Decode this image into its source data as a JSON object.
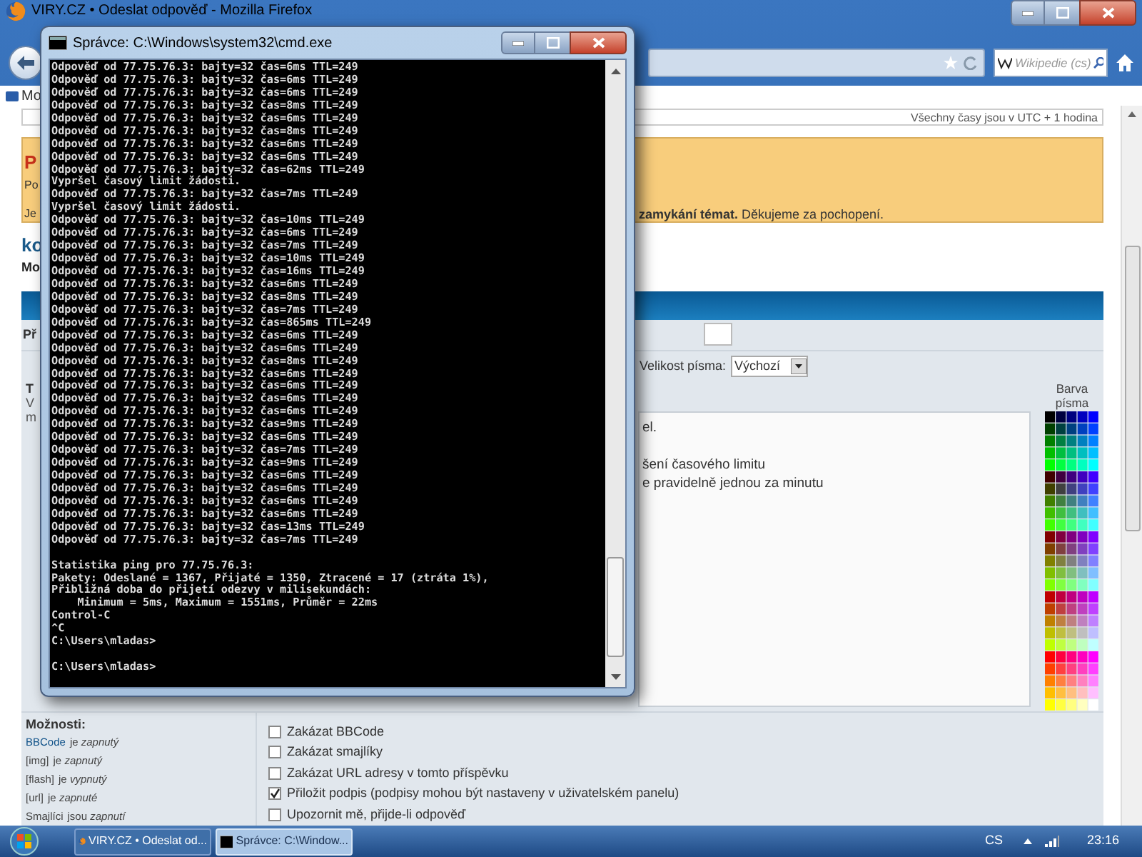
{
  "browser": {
    "title": "VIRY.CZ • Odeslat odpověď - Mozilla Firefox",
    "search": {
      "placeholder": "Wikipedie (cs)"
    },
    "bookmark": "Mo"
  },
  "page": {
    "timezone": "Všechny časy jsou v UTC + 1 hodina",
    "notice": {
      "heading": "P",
      "line_1": "Po",
      "line_2_start": "Je",
      "line_2_end": "**zamykání témat.** Děkujeme za pochopení."
    },
    "topic": {
      "title": "ko",
      "subtitle": "Mo"
    },
    "subject_label": "Př",
    "font_size": {
      "label": "Velikost písma:",
      "value": "Výchozí"
    },
    "help_fragments": [
      "T",
      "V",
      "m"
    ],
    "message_lines": [
      "el.",
      "šení časového limitu",
      "e pravidelně jednou za minutu"
    ],
    "color_label": "Barva písma",
    "options": {
      "heading": "Možnosti:",
      "items": [
        {
          "lead": "BBCode",
          "link": true,
          "rest": "je *zapnutý*"
        },
        {
          "lead": "[img]",
          "link": false,
          "rest": "je *zapnutý*"
        },
        {
          "lead": "[flash]",
          "link": false,
          "rest": "je *vypnutý*"
        },
        {
          "lead": "[url]",
          "link": false,
          "rest": "je *zapnuté*"
        },
        {
          "lead": "Smajlíci",
          "link": false,
          "rest": "jsou *zapnutí*"
        }
      ]
    },
    "checkboxes": [
      {
        "label": "Zakázat BBCode",
        "checked": false
      },
      {
        "label": "Zakázat smajlíky",
        "checked": false
      },
      {
        "label": "Zakázat URL adresy v tomto příspěvku",
        "checked": false
      },
      {
        "label": "Přiložit podpis (podpisy mohou být nastaveny v uživatelském panelu)",
        "checked": true
      },
      {
        "label": "Upozornit mě, přijde-li odpověď",
        "checked": false
      }
    ]
  },
  "console": {
    "title": "Správce: C:\\Windows\\system32\\cmd.exe",
    "lines": [
      {
        "kind": "line",
        "text": "Odpověď od 77.75.76.3: bajty=32 čas=6ms TTL=249"
      },
      {
        "kind": "line",
        "text": "Odpověď od 77.75.76.3: bajty=32 čas=6ms TTL=249"
      },
      {
        "kind": "line",
        "text": "Odpověď od 77.75.76.3: bajty=32 čas=6ms TTL=249"
      },
      {
        "kind": "line",
        "text": "Odpověď od 77.75.76.3: bajty=32 čas=8ms TTL=249"
      },
      {
        "kind": "line",
        "text": "Odpověď od 77.75.76.3: bajty=32 čas=6ms TTL=249"
      },
      {
        "kind": "line",
        "text": "Odpověď od 77.75.76.3: bajty=32 čas=8ms TTL=249"
      },
      {
        "kind": "line",
        "text": "Odpověď od 77.75.76.3: bajty=32 čas=6ms TTL=249"
      },
      {
        "kind": "line",
        "text": "Odpověď od 77.75.76.3: bajty=32 čas=6ms TTL=249"
      },
      {
        "kind": "line",
        "text": "Odpověď od 77.75.76.3: bajty=32 čas=62ms TTL=249"
      },
      {
        "kind": "line",
        "text": "Vypršel časový limit žádosti."
      },
      {
        "kind": "line",
        "text": "Odpověď od 77.75.76.3: bajty=32 čas=7ms TTL=249"
      },
      {
        "kind": "line",
        "text": "Vypršel časový limit žádosti."
      },
      {
        "kind": "line",
        "text": "Odpověď od 77.75.76.3: bajty=32 čas=10ms TTL=249"
      },
      {
        "kind": "line",
        "text": "Odpověď od 77.75.76.3: bajty=32 čas=6ms TTL=249"
      },
      {
        "kind": "line",
        "text": "Odpověď od 77.75.76.3: bajty=32 čas=7ms TTL=249"
      },
      {
        "kind": "line",
        "text": "Odpověď od 77.75.76.3: bajty=32 čas=10ms TTL=249"
      },
      {
        "kind": "line",
        "text": "Odpověď od 77.75.76.3: bajty=32 čas=16ms TTL=249"
      },
      {
        "kind": "line",
        "text": "Odpověď od 77.75.76.3: bajty=32 čas=6ms TTL=249"
      },
      {
        "kind": "line",
        "text": "Odpověď od 77.75.76.3: bajty=32 čas=8ms TTL=249"
      },
      {
        "kind": "line",
        "text": "Odpověď od 77.75.76.3: bajty=32 čas=7ms TTL=249"
      },
      {
        "kind": "line",
        "text": "Odpověď od 77.75.76.3: bajty=32 čas=865ms TTL=249"
      },
      {
        "kind": "line",
        "text": "Odpověď od 77.75.76.3: bajty=32 čas=6ms TTL=249"
      },
      {
        "kind": "line",
        "text": "Odpověď od 77.75.76.3: bajty=32 čas=6ms TTL=249"
      },
      {
        "kind": "line",
        "text": "Odpověď od 77.75.76.3: bajty=32 čas=8ms TTL=249"
      },
      {
        "kind": "line",
        "text": "Odpověď od 77.75.76.3: bajty=32 čas=6ms TTL=249"
      },
      {
        "kind": "line",
        "text": "Odpověď od 77.75.76.3: bajty=32 čas=6ms TTL=249"
      },
      {
        "kind": "line",
        "text": "Odpověď od 77.75.76.3: bajty=32 čas=6ms TTL=249"
      },
      {
        "kind": "line",
        "text": "Odpověď od 77.75.76.3: bajty=32 čas=6ms TTL=249"
      },
      {
        "kind": "line",
        "text": "Odpověď od 77.75.76.3: bajty=32 čas=9ms TTL=249"
      },
      {
        "kind": "line",
        "text": "Odpověď od 77.75.76.3: bajty=32 čas=6ms TTL=249"
      },
      {
        "kind": "line",
        "text": "Odpověď od 77.75.76.3: bajty=32 čas=7ms TTL=249"
      },
      {
        "kind": "line",
        "text": "Odpověď od 77.75.76.3: bajty=32 čas=9ms TTL=249"
      },
      {
        "kind": "line",
        "text": "Odpověď od 77.75.76.3: bajty=32 čas=6ms TTL=249"
      },
      {
        "kind": "line",
        "text": "Odpověď od 77.75.76.3: bajty=32 čas=6ms TTL=249"
      },
      {
        "kind": "line",
        "text": "Odpověď od 77.75.76.3: bajty=32 čas=6ms TTL=249"
      },
      {
        "kind": "line",
        "text": "Odpověď od 77.75.76.3: bajty=32 čas=6ms TTL=249"
      },
      {
        "kind": "line",
        "text": "Odpověď od 77.75.76.3: bajty=32 čas=13ms TTL=249"
      },
      {
        "kind": "line",
        "text": "Odpověď od 77.75.76.3: bajty=32 čas=7ms TTL=249"
      },
      {
        "kind": "blank"
      },
      {
        "kind": "line",
        "text": "Statistika ping pro 77.75.76.3:"
      },
      {
        "kind": "line",
        "text": "Pakety: Odeslané = 1367, Přijaté = 1350, Ztracené = 17 (ztráta 1%),"
      },
      {
        "kind": "line",
        "text": "Přibližná doba do přijetí odezvy v milisekundách:"
      },
      {
        "kind": "line",
        "text": "    Minimum = 5ms, Maximum = 1551ms, Průměr = 22ms"
      },
      {
        "kind": "line",
        "text": "Control-C"
      },
      {
        "kind": "line",
        "text": "^C"
      },
      {
        "kind": "line",
        "text": "C:\\Users\\mladas>"
      },
      {
        "kind": "blank"
      },
      {
        "kind": "line",
        "text": "C:\\Users\\mladas>"
      }
    ]
  },
  "taskbar": {
    "buttons": [
      {
        "label": "VIRY.CZ • Odeslat od...",
        "kind": "browser",
        "selected": false
      },
      {
        "label": "Správce: C:\\Window...",
        "kind": "console",
        "selected": true
      }
    ],
    "language": "CS",
    "time": "23:16"
  }
}
